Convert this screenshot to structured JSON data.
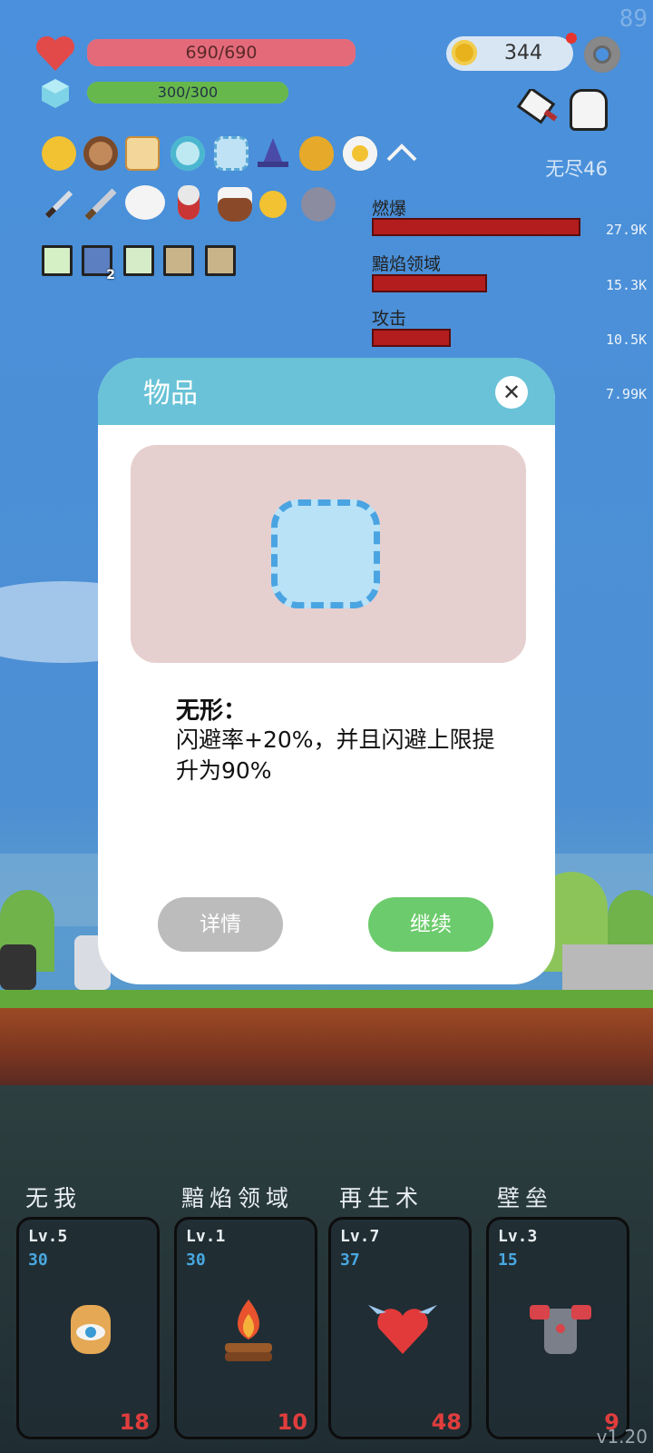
{
  "fps": "89",
  "hp": {
    "text": "690/690",
    "fraction": 1.0
  },
  "mana": {
    "text": "300/300",
    "fraction": 1.0
  },
  "coins": "344",
  "wave_label": "无尽46",
  "icons_row1": [
    "sunflower-icon",
    "shield-icon",
    "scroll-icon",
    "target-icon",
    "dashed-square-icon",
    "wizard-hat-icon",
    "pineapple-icon",
    "flower-icon",
    "chevron-up-icon"
  ],
  "icons_row2": [
    "dagger-icon",
    "sword-icon",
    "speech-bubble-icon",
    "potion-icon",
    "acorn-icon",
    "sun-icon",
    "stone-icon"
  ],
  "buff_row": [
    "buff-lightbulb-icon",
    "buff-splash-icon",
    "buff-leaf-icon",
    "buff-armor-icon",
    "buff-armor2-icon"
  ],
  "buff_count": "2",
  "damage_stats": [
    {
      "name": "燃爆",
      "value": "27.9K",
      "fraction": 1.0
    },
    {
      "name": "黯焰领域",
      "value": "15.3K",
      "fraction": 0.55
    },
    {
      "name": "攻击",
      "value": "10.5K",
      "fraction": 0.38
    },
    {
      "name": "",
      "value": "7.99K",
      "fraction": 0.0
    }
  ],
  "modal": {
    "title": "物品",
    "close_glyph": "✕",
    "item_name": "无形：",
    "item_desc": "闪避率+20%，并且闪避上限提升为90%",
    "details_label": "详情",
    "continue_label": "继续"
  },
  "skills": [
    {
      "name": "无我",
      "level": "Lv.5",
      "cost": "30",
      "count": "18",
      "icon": "eye-hand-icon"
    },
    {
      "name": "黯焰领域",
      "level": "Lv.1",
      "cost": "30",
      "count": "10",
      "icon": "campfire-icon"
    },
    {
      "name": "再生术",
      "level": "Lv.7",
      "cost": "37",
      "count": "48",
      "icon": "winged-heart-icon"
    },
    {
      "name": "壁垒",
      "level": "Lv.3",
      "cost": "15",
      "count": "9",
      "icon": "armor-icon"
    }
  ],
  "version": "v1.20",
  "colors": {
    "hp": "#e46a7a",
    "mana": "#67b84c",
    "panel_header": "#69c2d7",
    "continue": "#6ccb6c",
    "details": "#bcbcbc"
  }
}
